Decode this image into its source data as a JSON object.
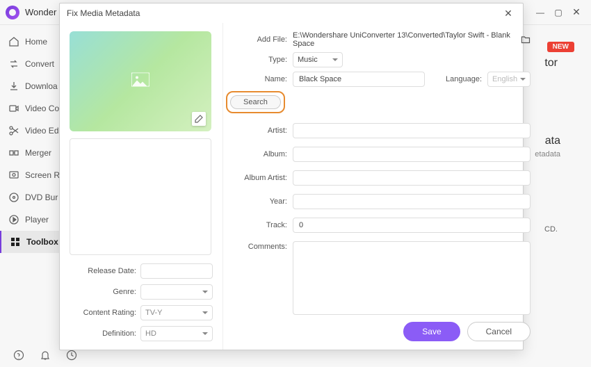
{
  "app": {
    "title": "Wonder"
  },
  "sidebar": {
    "items": [
      {
        "label": "Home"
      },
      {
        "label": "Convert"
      },
      {
        "label": "Downloa"
      },
      {
        "label": "Video Co"
      },
      {
        "label": "Video Ed"
      },
      {
        "label": "Merger"
      },
      {
        "label": "Screen R"
      },
      {
        "label": "DVD Bur"
      },
      {
        "label": "Player"
      },
      {
        "label": "Toolbox"
      }
    ]
  },
  "bg": {
    "tor": "tor",
    "ata": "ata",
    "sub": "etadata",
    "cd": "CD.",
    "new": "NEW"
  },
  "dialog": {
    "title": "Fix Media Metadata",
    "addFile": {
      "label": "Add File:",
      "value": "E:\\Wondershare UniConverter 13\\Converted\\Taylor Swift - Blank Space"
    },
    "type": {
      "label": "Type:",
      "value": "Music"
    },
    "name": {
      "label": "Name:",
      "value": "Black Space"
    },
    "language": {
      "label": "Language:",
      "value": "English"
    },
    "searchLabel": "Search",
    "artist": {
      "label": "Artist:",
      "value": ""
    },
    "album": {
      "label": "Album:",
      "value": ""
    },
    "albumArtist": {
      "label": "Album Artist:",
      "value": ""
    },
    "year": {
      "label": "Year:",
      "value": ""
    },
    "track": {
      "label": "Track:",
      "value": "0"
    },
    "comments": {
      "label": "Comments:",
      "value": ""
    },
    "left": {
      "releaseDate": {
        "label": "Release Date:",
        "value": ""
      },
      "genre": {
        "label": "Genre:",
        "value": ""
      },
      "contentRating": {
        "label": "Content Rating:",
        "value": "TV-Y"
      },
      "definition": {
        "label": "Definition:",
        "value": "HD"
      }
    },
    "save": "Save",
    "cancel": "Cancel"
  }
}
